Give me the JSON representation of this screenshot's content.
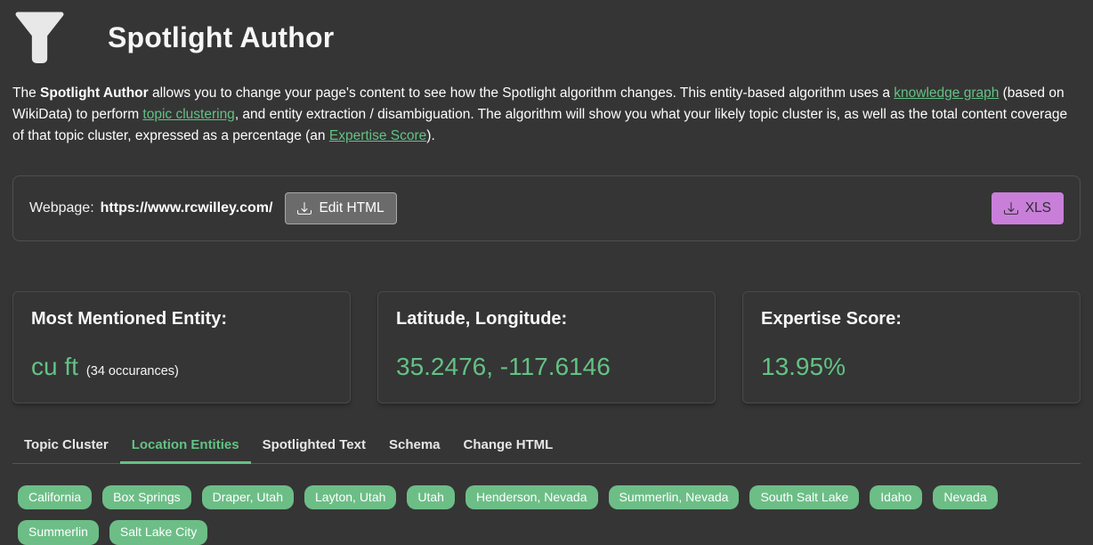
{
  "header": {
    "title": "Spotlight Author",
    "icon": "funnel-icon"
  },
  "description": {
    "segments": [
      {
        "text": "The ",
        "style": "normal"
      },
      {
        "text": "Spotlight Author",
        "style": "bold"
      },
      {
        "text": " allows you to change your page's content to see how the Spotlight algorithm changes. This entity-based algorithm uses a ",
        "style": "normal"
      },
      {
        "text": "knowledge graph",
        "style": "link"
      },
      {
        "text": " (based on WikiData) to perform ",
        "style": "normal"
      },
      {
        "text": "topic clustering",
        "style": "link"
      },
      {
        "text": ", and entity extraction / disambiguation. The algorithm will show you what your likely topic cluster is, as well as the total content coverage of that topic cluster, expressed as a percentage (an ",
        "style": "normal"
      },
      {
        "text": "Expertise Score",
        "style": "link"
      },
      {
        "text": ").",
        "style": "normal"
      }
    ]
  },
  "webpage_bar": {
    "label": "Webpage:",
    "url": "https://www.rcwilley.com/",
    "edit_button": {
      "label": "Edit HTML",
      "icon": "download-icon"
    },
    "xls_button": {
      "label": "XLS",
      "icon": "download-icon"
    }
  },
  "cards": [
    {
      "title": "Most Mentioned Entity:",
      "value": "cu ft",
      "note": "(34 occurances)"
    },
    {
      "title": "Latitude, Longitude:",
      "value": "35.2476, -117.6146"
    },
    {
      "title": "Expertise Score:",
      "value": "13.95%"
    }
  ],
  "tabs": {
    "active": "Location Entities",
    "items": [
      "Topic Cluster",
      "Location Entities",
      "Spotlighted Text",
      "Schema",
      "Change HTML"
    ]
  },
  "location_entities": [
    "California",
    "Box Springs",
    "Draper, Utah",
    "Layton, Utah",
    "Utah",
    "Henderson, Nevada",
    "Summerlin, Nevada",
    "South Salt Lake",
    "Idaho",
    "Nevada",
    "Summerlin",
    "Salt Lake City"
  ],
  "colors": {
    "bg": "#353535",
    "accent_green": "#63c284",
    "badge_green": "#6cbe86",
    "xls_purple": "#c97fd9",
    "btn_gray_bg": "#6b6b6b",
    "btn_gray_border": "#a8a8a8"
  }
}
